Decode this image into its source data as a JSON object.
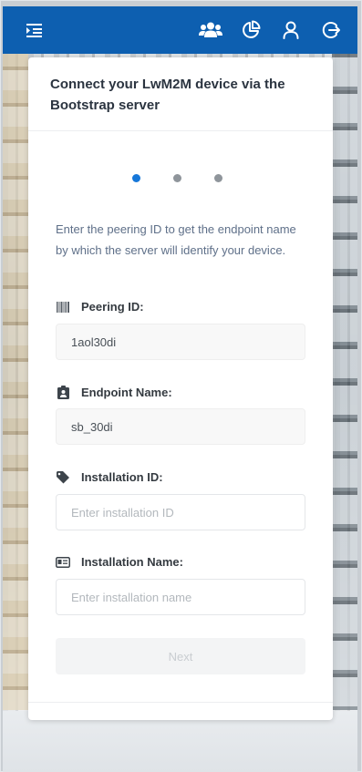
{
  "header": {
    "background_color": "#0d5fb0",
    "menu_icon": "menu-indent-icon",
    "actions": [
      {
        "name": "users-icon"
      },
      {
        "name": "pie-chart-icon"
      },
      {
        "name": "user-icon"
      },
      {
        "name": "logout-icon"
      }
    ]
  },
  "card": {
    "title": "Connect your LwM2M device via the Bootstrap server",
    "steps": {
      "total": 3,
      "active": 1
    },
    "intro": "Enter the peering ID to get the endpoint name by which the server will identify your device.",
    "fields": {
      "peering_id": {
        "label": "Peering ID:",
        "icon": "barcode-icon",
        "value": "1aol30di"
      },
      "endpoint_name": {
        "label": "Endpoint Name:",
        "icon": "id-badge-icon",
        "value": "sb_30di"
      },
      "installation_id": {
        "label": "Installation ID:",
        "icon": "tag-icon",
        "value": "",
        "placeholder": "Enter installation ID"
      },
      "installation_name": {
        "label": "Installation Name:",
        "icon": "id-card-icon",
        "value": "",
        "placeholder": "Enter installation name"
      }
    },
    "next_label": "Next",
    "accent_color": "#1677d9"
  }
}
